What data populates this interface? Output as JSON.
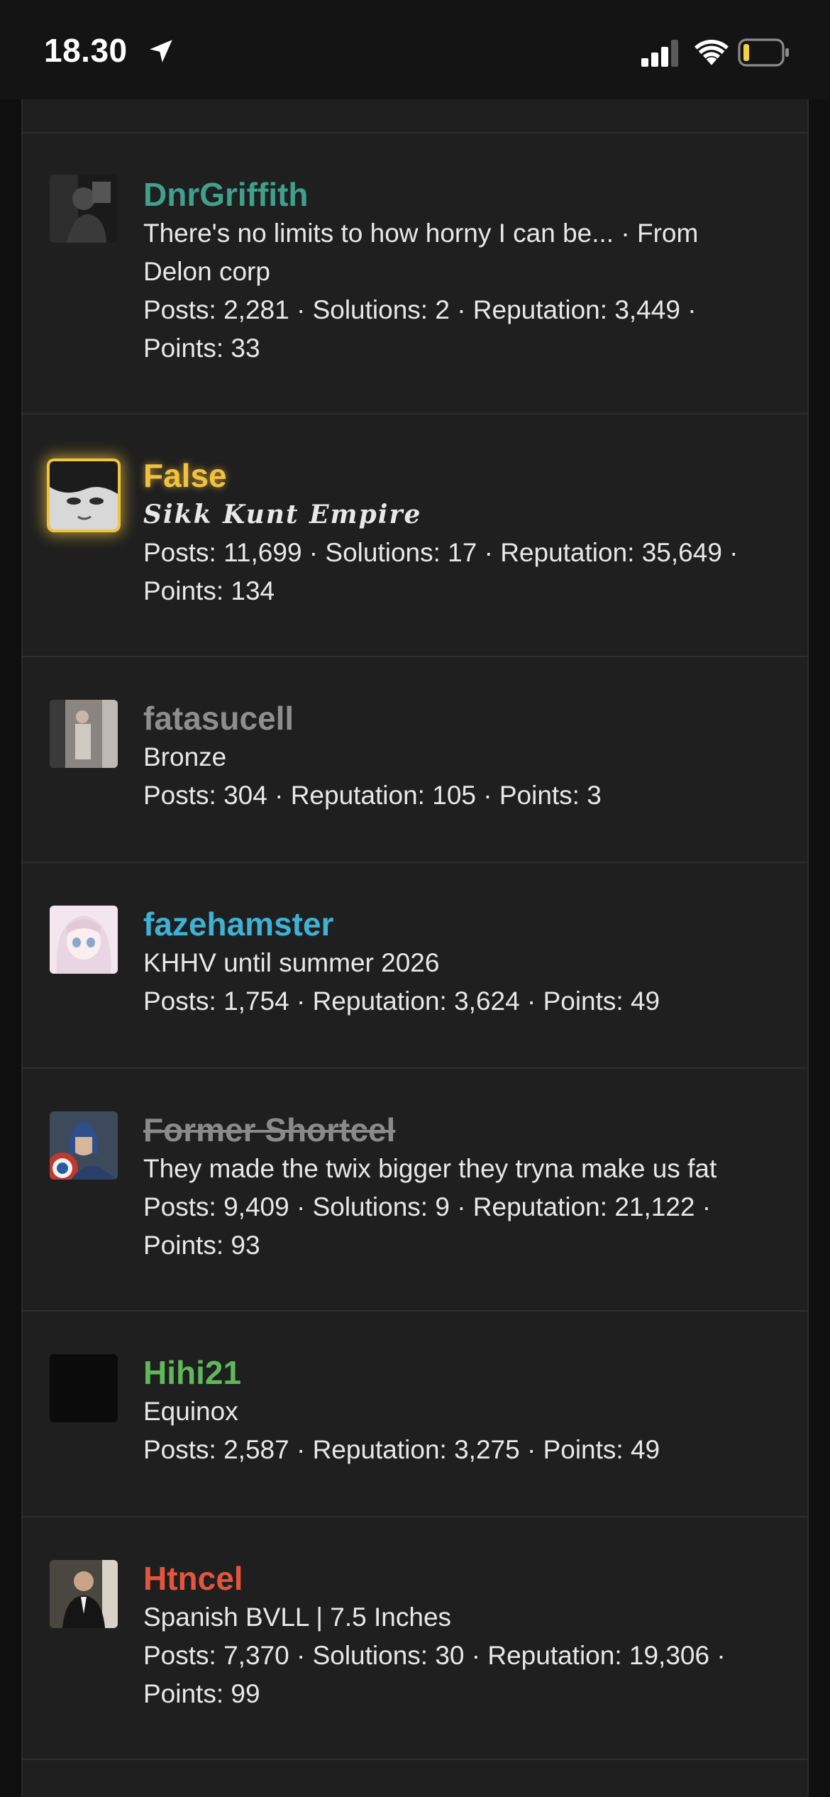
{
  "status_bar": {
    "time": "18.30",
    "icons": [
      "location-arrow-icon",
      "cellular-signal-icon",
      "wifi-icon",
      "battery-low-icon"
    ]
  },
  "members": [
    {
      "name": "DnrGriffith",
      "name_color": "#3fa08c",
      "title_lines": [
        "There's no limits to how horny I can be... · From",
        "Delon corp"
      ],
      "stats_lines": [
        "Posts: 2,281 · Solutions: 2 · Reputation: 3,449 ·",
        "Points: 33"
      ]
    },
    {
      "name": "False",
      "name_color": "#f2c23e",
      "title_lines": [
        "Sikk Kunt Empire"
      ],
      "stats_lines": [
        "Posts: 11,699 · Solutions: 17 · Reputation: 35,649 ·",
        "Points: 134"
      ]
    },
    {
      "name": "fatasucell",
      "name_color": "#8e8e8e",
      "title_lines": [
        "Bronze"
      ],
      "stats_lines": [
        "Posts: 304 · Reputation: 105 · Points: 3"
      ]
    },
    {
      "name": "fazehamster",
      "name_color": "#3eb1d4",
      "title_lines": [
        "KHHV until summer 2026"
      ],
      "stats_lines": [
        "Posts: 1,754 · Reputation: 3,624 · Points: 49"
      ]
    },
    {
      "name": "Former Shortcel",
      "name_color": "#8a8a8a",
      "title_lines": [
        "They made the twix bigger they tryna make us fat"
      ],
      "stats_lines": [
        "Posts: 9,409 · Solutions: 9 · Reputation: 21,122 ·",
        "Points: 93"
      ]
    },
    {
      "name": "Hihi21",
      "name_color": "#5fb85a",
      "title_lines": [
        "Equinox"
      ],
      "stats_lines": [
        "Posts: 2,587 · Reputation: 3,275 · Points: 49"
      ]
    },
    {
      "name": "Htncel",
      "name_color": "#e4553c",
      "title_lines": [
        "Spanish BVLL | 7.5 Inches"
      ],
      "stats_lines": [
        "Posts: 7,370 · Solutions: 30 · Reputation: 19,306 ·",
        "Points: 99"
      ]
    }
  ]
}
